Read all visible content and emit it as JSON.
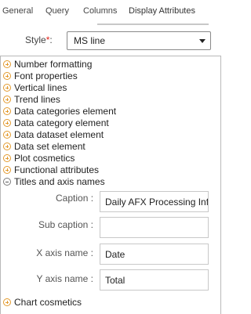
{
  "tabs": [
    {
      "label": "General"
    },
    {
      "label": "Query"
    },
    {
      "label": "Columns"
    },
    {
      "label": "Display Attributes",
      "active": true
    }
  ],
  "style": {
    "label": "Style",
    "required_mark": "*",
    "colon": ":",
    "value": "MS line"
  },
  "sections": [
    {
      "label": "Number formatting",
      "expanded": false
    },
    {
      "label": "Font properties",
      "expanded": false
    },
    {
      "label": "Vertical lines",
      "expanded": false
    },
    {
      "label": "Trend lines",
      "expanded": false
    },
    {
      "label": "Data categories element",
      "expanded": false
    },
    {
      "label": "Data category element",
      "expanded": false
    },
    {
      "label": "Data dataset element",
      "expanded": false
    },
    {
      "label": "Data set element",
      "expanded": false
    },
    {
      "label": "Plot cosmetics",
      "expanded": false
    },
    {
      "label": "Functional attributes",
      "expanded": false
    },
    {
      "label": "Titles and axis names",
      "expanded": true
    },
    {
      "label": "Chart cosmetics",
      "expanded": false
    }
  ],
  "titles_fields": {
    "caption": {
      "label": "Caption :",
      "value": "Daily AFX Processing Info"
    },
    "subcaption": {
      "label": "Sub caption :",
      "value": ""
    },
    "xaxis": {
      "label": "X axis name :",
      "value": "Date"
    },
    "yaxis": {
      "label": "Y axis name :",
      "value": "Total"
    }
  },
  "colors": {
    "accent_icon": "#e39a2d",
    "required": "#e2231a"
  }
}
